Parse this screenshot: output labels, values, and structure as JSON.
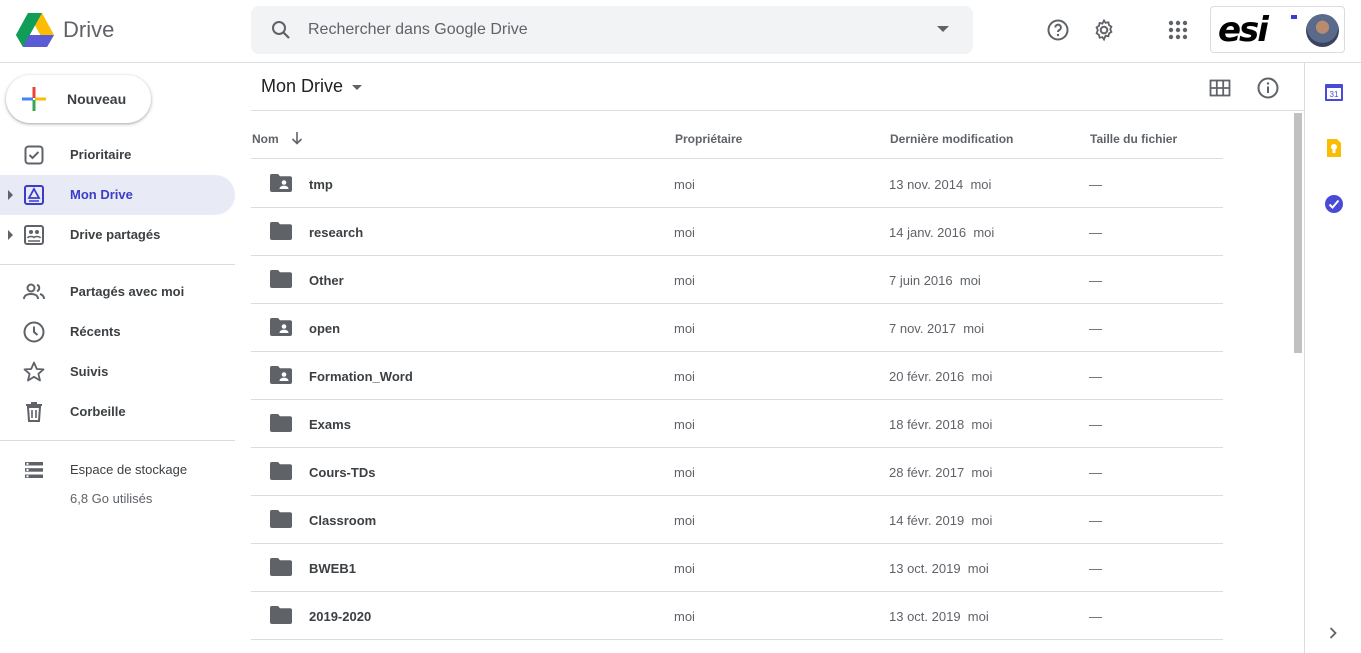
{
  "app": {
    "title": "Drive"
  },
  "search": {
    "placeholder": "Rechercher dans Google Drive"
  },
  "header_icons": [
    "help-icon",
    "settings-icon",
    "apps-icon"
  ],
  "account": {
    "brand_text": "esi"
  },
  "sidebar": {
    "new_label": "Nouveau",
    "items": [
      {
        "label": "Prioritaire",
        "icon": "priority-icon"
      },
      {
        "label": "Mon Drive",
        "icon": "my-drive-icon",
        "active": true
      },
      {
        "label": "Drive partagés",
        "icon": "shared-drives-icon"
      },
      {
        "label": "Partagés avec moi",
        "icon": "shared-with-me-icon"
      },
      {
        "label": "Récents",
        "icon": "clock-icon"
      },
      {
        "label": "Suivis",
        "icon": "star-icon"
      },
      {
        "label": "Corbeille",
        "icon": "trash-icon"
      }
    ],
    "storage": {
      "label": "Espace de stockage",
      "used": "6,8 Go utilisés"
    }
  },
  "main": {
    "breadcrumb": "Mon Drive",
    "columns": {
      "name": "Nom",
      "owner": "Propriétaire",
      "modified": "Dernière modification",
      "size": "Taille du fichier"
    },
    "files": [
      {
        "name": "tmp",
        "type": "shared-folder",
        "owner": "moi",
        "modified": "13 nov. 2014",
        "modified_by": "moi",
        "size": "—"
      },
      {
        "name": "research",
        "type": "folder",
        "owner": "moi",
        "modified": "14 janv. 2016",
        "modified_by": "moi",
        "size": "—"
      },
      {
        "name": "Other",
        "type": "folder",
        "owner": "moi",
        "modified": "7 juin 2016",
        "modified_by": "moi",
        "size": "—"
      },
      {
        "name": "open",
        "type": "shared-folder",
        "owner": "moi",
        "modified": "7 nov. 2017",
        "modified_by": "moi",
        "size": "—"
      },
      {
        "name": "Formation_Word",
        "type": "shared-folder",
        "owner": "moi",
        "modified": "20 févr. 2016",
        "modified_by": "moi",
        "size": "—"
      },
      {
        "name": "Exams",
        "type": "folder",
        "owner": "moi",
        "modified": "18 févr. 2018",
        "modified_by": "moi",
        "size": "—"
      },
      {
        "name": "Cours-TDs",
        "type": "folder",
        "owner": "moi",
        "modified": "28 févr. 2017",
        "modified_by": "moi",
        "size": "—"
      },
      {
        "name": "Classroom",
        "type": "folder",
        "owner": "moi",
        "modified": "14 févr. 2019",
        "modified_by": "moi",
        "size": "—"
      },
      {
        "name": "BWEB1",
        "type": "folder",
        "owner": "moi",
        "modified": "13 oct. 2019",
        "modified_by": "moi",
        "size": "—"
      },
      {
        "name": "2019-2020",
        "type": "folder",
        "owner": "moi",
        "modified": "13 oct. 2019",
        "modified_by": "moi",
        "size": "—"
      }
    ]
  },
  "right_panel": {
    "calendar_day": "31",
    "icons": [
      "calendar-icon",
      "keep-icon",
      "tasks-icon",
      "chevron-right-icon"
    ]
  },
  "colors": {
    "accent": "#3c3cc8",
    "active_bg": "#e8eaf6",
    "folder": "#5f6368"
  }
}
